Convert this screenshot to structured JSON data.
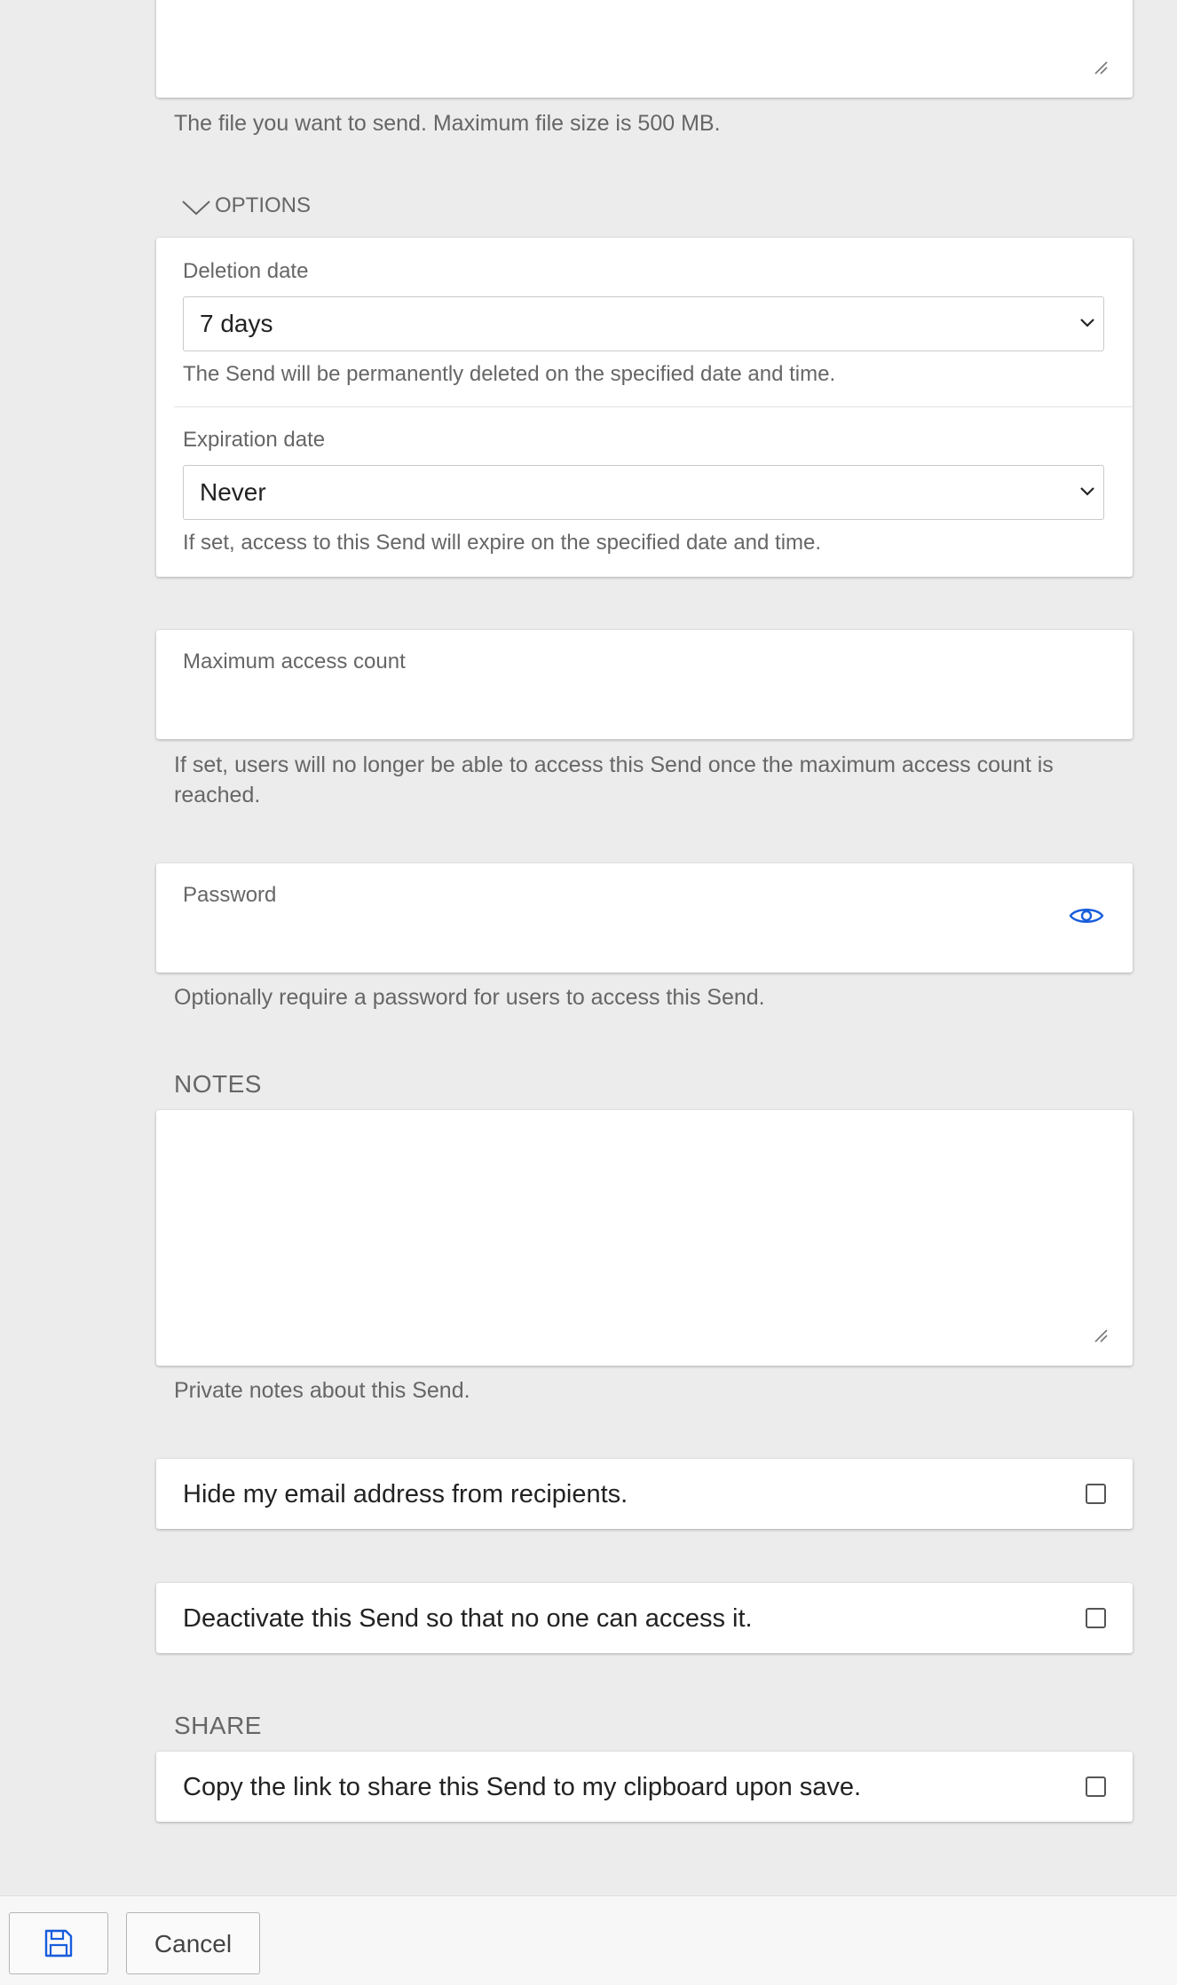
{
  "file": {
    "help": "The file you want to send. Maximum file size is 500 MB."
  },
  "options": {
    "toggle_label": "OPTIONS",
    "deletion": {
      "label": "Deletion date",
      "value": "7 days",
      "help": "The Send will be permanently deleted on the specified date and time."
    },
    "expiration": {
      "label": "Expiration date",
      "value": "Never",
      "help": "If set, access to this Send will expire on the specified date and time."
    }
  },
  "max_access": {
    "label": "Maximum access count",
    "value": "",
    "help": "If set, users will no longer be able to access this Send once the maximum access count is reached."
  },
  "password": {
    "label": "Password",
    "value": "",
    "help": "Optionally require a password for users to access this Send."
  },
  "notes": {
    "section_label": "NOTES",
    "value": "",
    "help": "Private notes about this Send."
  },
  "hide_email": {
    "label": "Hide my email address from recipients.",
    "checked": false
  },
  "deactivate": {
    "label": "Deactivate this Send so that no one can access it.",
    "checked": false
  },
  "share": {
    "section_label": "SHARE",
    "copy_link_label": "Copy the link to share this Send to my clipboard upon save.",
    "checked": false
  },
  "footer": {
    "save_icon": "floppy-disk-icon",
    "cancel_label": "Cancel"
  },
  "colors": {
    "background": "#ececec",
    "accent": "#175ddc",
    "text": "#333333",
    "muted": "#666666"
  }
}
